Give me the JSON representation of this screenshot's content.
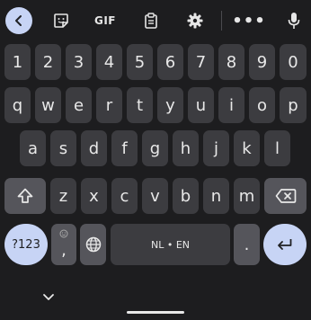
{
  "toolbar": {
    "gif_label": "GIF",
    "more_label": "•••",
    "icons": [
      "chevron-left-icon",
      "sticker-icon",
      "clipboard-icon",
      "gear-icon",
      "mic-icon"
    ]
  },
  "keyboard": {
    "row_numbers": [
      "1",
      "2",
      "3",
      "4",
      "5",
      "6",
      "7",
      "8",
      "9",
      "0"
    ],
    "row_q": [
      "q",
      "w",
      "e",
      "r",
      "t",
      "y",
      "u",
      "i",
      "o",
      "p"
    ],
    "row_a": [
      "a",
      "s",
      "d",
      "f",
      "g",
      "h",
      "j",
      "k",
      "l"
    ],
    "row_z": [
      "z",
      "x",
      "c",
      "v",
      "b",
      "n",
      "m"
    ],
    "symbols_label": "?123",
    "comma_label": ",",
    "space_label": "NL • EN",
    "period_label": "."
  },
  "colors": {
    "background": "#1d1d1f",
    "key": "#3c3c40",
    "special_key": "#55555b",
    "accent": "#c7d4f5"
  }
}
